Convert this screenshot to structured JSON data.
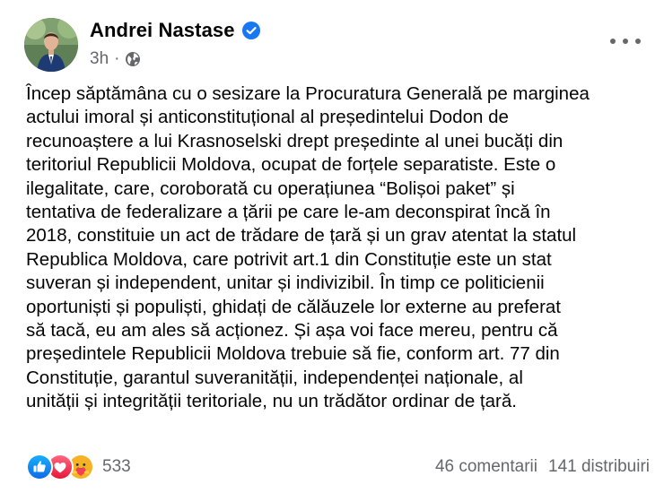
{
  "post": {
    "author_name": "Andrei Nastase",
    "time": "3h",
    "text": "Încep săptămâna cu o sesizare la Procuratura Generală pe marginea\nactului imoral și anticonstituțional al președintelui Dodon de\nrecunoaștere a lui Krasnoselski drept președinte al unei bucăți din\nteritoriul Republicii Moldova, ocupat de forțele separatiste. Este o\nilegalitate, care, coroborată cu operațiunea “Bolișoi paket” și\ntentativa de federalizare a țării pe care le-am deconspirat încă în\n2018, constituie un act de trădare de țară și un grav atentat la statul\nRepublica Moldova, care potrivit art.1 din Constituție este un stat\nsuveran și independent, unitar și indivizibil. În timp ce politicienii\noportuniști și populiști, ghidați de călăuzele lor externe au preferat\nsă tacă, eu am ales să acționez. Și așa voi face mereu, pentru că\npreședintele Republicii Moldova trebuie să fie, conform art. 77 din\nConstituție, garantul suveranității, independenței naționale, al\nunității și integrității teritoriale, nu un trădător ordinar de țară.",
    "reactions": {
      "icons": [
        "like-icon",
        "love-icon",
        "care-icon"
      ],
      "count": "533"
    },
    "comments": "46 comentarii",
    "shares": "141 distribuiri"
  },
  "colors": {
    "verified": "#1877f2",
    "secondary_text": "#65676b",
    "like": "#1877f2",
    "love": "#f33e58",
    "care": "#f7b125"
  }
}
